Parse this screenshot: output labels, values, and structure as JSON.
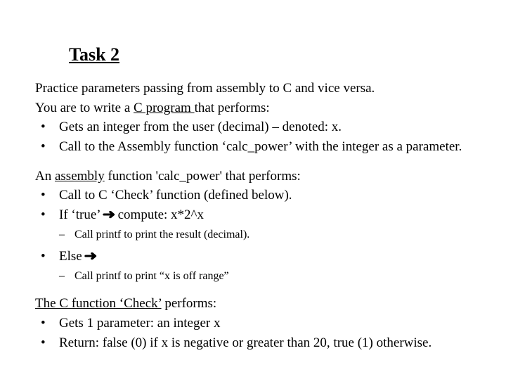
{
  "title": "Task 2",
  "block1": {
    "line1": "Practice parameters passing from assembly to C and vice versa.",
    "line2a": "You are to write a ",
    "line2u": "C program ",
    "line2b": "that performs:",
    "bullet1": "Gets an integer from the user (decimal) – denoted: x.",
    "bullet2": "Call to the Assembly function ‘calc_power’ with the integer as a parameter."
  },
  "block2": {
    "line1a": "An ",
    "line1u": "assembly",
    "line1b": " function 'calc_power' that performs:",
    "bullet1": "Call to C ‘Check’ function (defined below).",
    "bullet2a": "If ‘true’ ",
    "bullet2b": " compute: x*2^x",
    "sub1": "Call printf to print the result (decimal).",
    "bullet3": "Else ",
    "sub2": "Call printf to print “x is off range”"
  },
  "block3": {
    "line1u": "The C function ‘Check’",
    "line1b": " performs:",
    "bullet1": "Gets 1 parameter: an integer  x",
    "bullet2": "Return: false (0) if x is negative or greater than 20, true (1) otherwise."
  },
  "arrow": "➜"
}
